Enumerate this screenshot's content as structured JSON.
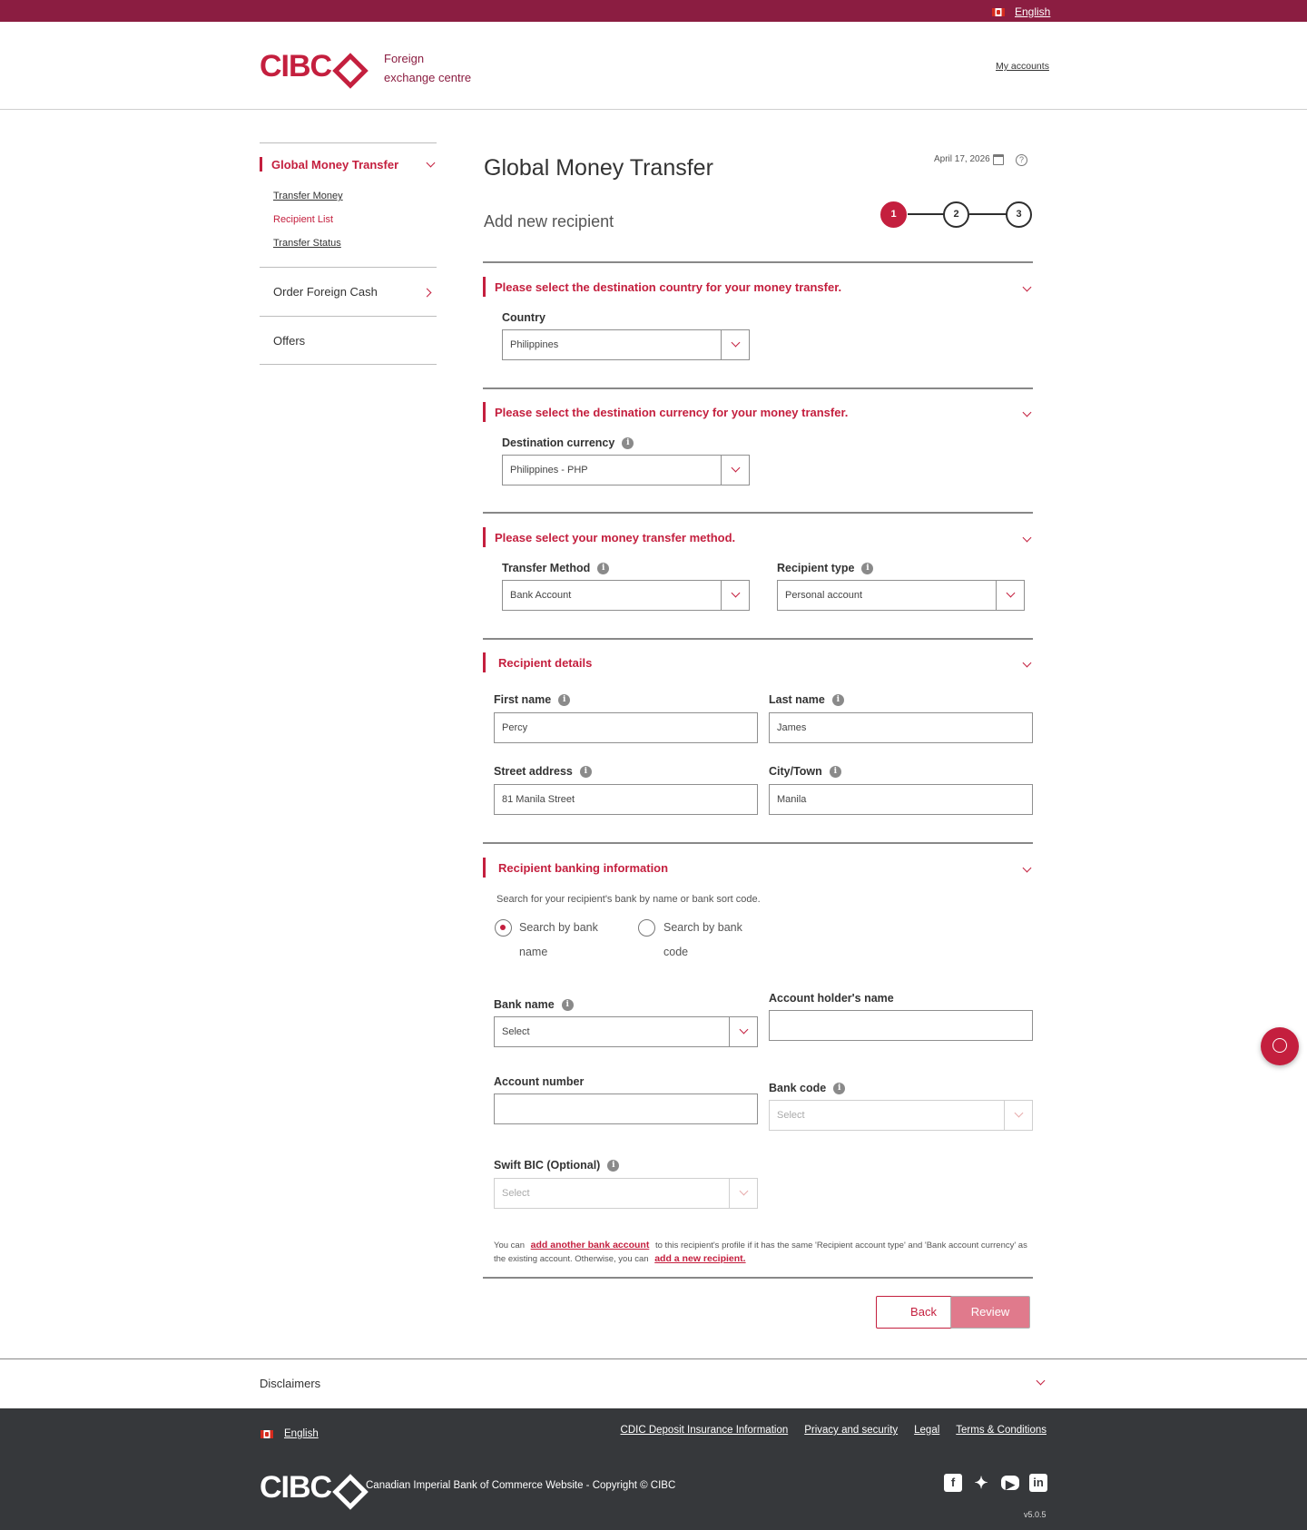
{
  "topbar": {
    "language": "English"
  },
  "header": {
    "logo_text": "CIBC",
    "subtitle": "Foreign exchange centre",
    "my_accounts": "My accounts"
  },
  "sidebar": {
    "section_title": "Global Money Transfer",
    "sub_items": [
      {
        "label": "Transfer Money",
        "active": false
      },
      {
        "label": "Recipient List",
        "active": true
      },
      {
        "label": "Transfer Status",
        "active": false
      }
    ],
    "items": [
      {
        "label": "Order Foreign Cash"
      },
      {
        "label": "Offers"
      }
    ]
  },
  "main": {
    "title": "Global Money Transfer",
    "subtitle": "Add new recipient",
    "date": "April 17, 2026",
    "steps": [
      "1",
      "2",
      "3"
    ],
    "active_step": 1,
    "sections": {
      "country": {
        "title": "Please select the destination country for your money transfer.",
        "country_label": "Country",
        "country_value": "Philippines"
      },
      "currency": {
        "title": "Please select the destination currency for your money transfer.",
        "currency_label": "Destination currency",
        "currency_value": "Philippines - PHP"
      },
      "method": {
        "title": "Please select your money transfer method.",
        "method_label": "Transfer Method",
        "method_value": "Bank Account",
        "recipient_type_label": "Recipient type",
        "recipient_type_value": "Personal account"
      },
      "recipient": {
        "title": "Recipient details",
        "first_name_label": "First name",
        "first_name_value": "Percy",
        "last_name_label": "Last name",
        "last_name_value": "James",
        "street_label": "Street address",
        "street_value": "81 Manila Street",
        "city_label": "City/Town",
        "city_value": "Manila"
      },
      "banking": {
        "title": "Recipient banking information",
        "hint": "Search for your recipient's bank by name or bank sort code.",
        "radio_by_name": "Search by bank name",
        "radio_by_code": "Search by bank code",
        "bank_name_label": "Bank name",
        "bank_name_value": "Select",
        "holder_label": "Account holder's name",
        "holder_value": "",
        "account_number_label": "Account number",
        "account_number_value": "",
        "bank_code_label": "Bank code",
        "bank_code_value": "Select",
        "swift_label": "Swift BIC (Optional)",
        "swift_value": "Select"
      }
    },
    "note": {
      "part1": "You can",
      "link1": "add another bank account",
      "part2": "to this recipient's profile if it has the same 'Recipient account type' and 'Bank account currency' as the existing account. Otherwise, you can",
      "link2": "add a new recipient."
    },
    "buttons": {
      "back": "Back",
      "review": "Review"
    }
  },
  "disclaimers": "Disclaimers",
  "footer": {
    "language": "English",
    "links": [
      "CDIC Deposit Insurance Information",
      "Privacy and security",
      "Legal",
      "Terms & Conditions"
    ],
    "logo_text": "CIBC",
    "copyright": "Canadian Imperial Bank of Commerce Website - Copyright © CIBC",
    "social": [
      "facebook-icon",
      "twitter-icon",
      "youtube-icon",
      "linkedin-icon"
    ],
    "version": "v5.0.5"
  },
  "colors": {
    "brand": "#c41f3e",
    "topbar": "#8b1d41",
    "footer": "#36383b"
  }
}
